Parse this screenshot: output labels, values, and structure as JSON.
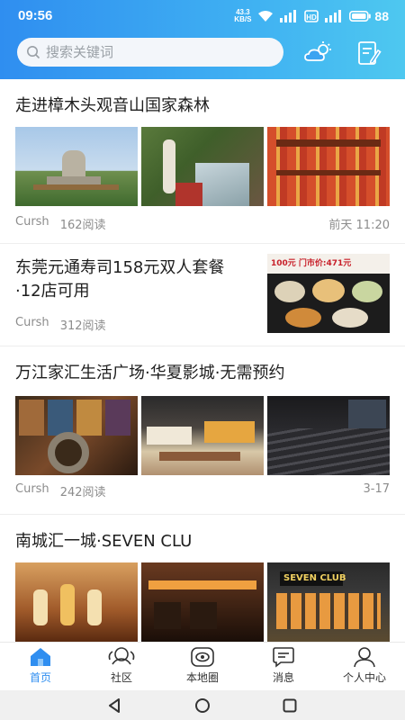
{
  "status_bar": {
    "time": "09:56",
    "net_speed_value": "43.3",
    "net_speed_unit": "KB/S",
    "battery": "88"
  },
  "header": {
    "search_placeholder": "搜索关键词",
    "weather_icon": "weather-cloud-sun-icon",
    "edit_icon": "edit-note-icon"
  },
  "feed": {
    "articles": [
      {
        "title": "走进樟木头观音山国家森林",
        "author": "Cursh",
        "reads": "162阅读",
        "time": "前天 11:20",
        "layout": "three-images"
      },
      {
        "title_line1": "东莞元通寿司158元双人套餐",
        "title_line2": "·12店可用",
        "author": "Cursh",
        "reads": "312阅读",
        "layout": "right-image",
        "promo_text": "100元 门市价:471元"
      },
      {
        "title": "万江家汇生活广场·华夏影城·无需预约",
        "author": "Cursh",
        "reads": "242阅读",
        "time": "3-17",
        "layout": "three-images"
      },
      {
        "title": "南城汇一城·SEVEN CLU",
        "layout": "three-images",
        "club_sign": "SEVEN CLUB"
      }
    ]
  },
  "tabbar": {
    "tabs": [
      {
        "label": "首页",
        "icon": "home-icon",
        "active": true
      },
      {
        "label": "社区",
        "icon": "community-icon",
        "active": false
      },
      {
        "label": "本地圈",
        "icon": "local-circle-icon",
        "active": false
      },
      {
        "label": "消息",
        "icon": "message-icon",
        "active": false
      },
      {
        "label": "个人中心",
        "icon": "user-icon",
        "active": false
      }
    ]
  },
  "colors": {
    "accent": "#2f8ef0",
    "header_gradient_end": "#4ec8f0",
    "meta_text": "#8c8c8c"
  }
}
